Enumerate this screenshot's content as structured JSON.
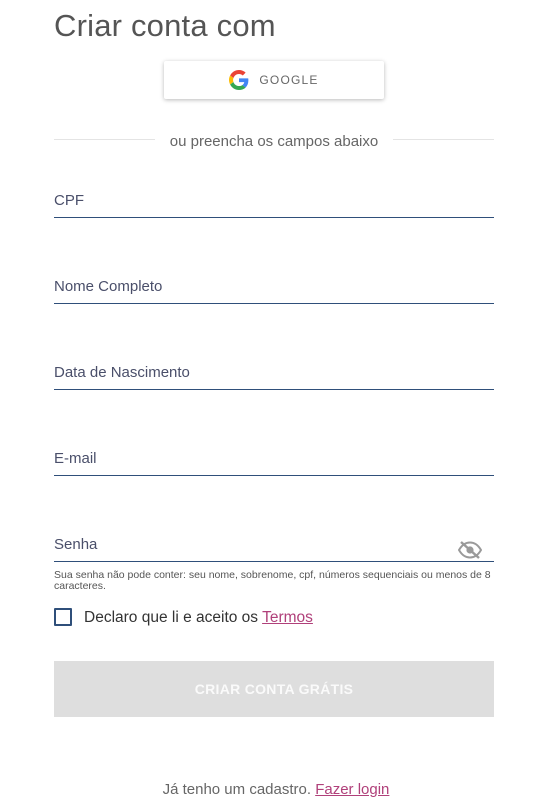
{
  "header": {
    "title": "Criar conta com"
  },
  "social": {
    "google_label": "GOOGLE",
    "icon": "google-icon"
  },
  "divider": {
    "text": "ou preencha os campos abaixo"
  },
  "form": {
    "fields": [
      {
        "label": "CPF",
        "value": ""
      },
      {
        "label": "Nome Completo",
        "value": ""
      },
      {
        "label": "Data de Nascimento",
        "value": ""
      },
      {
        "label": "E-mail",
        "value": ""
      },
      {
        "label": "Senha",
        "value": "",
        "icon": "eye-off-icon"
      }
    ],
    "password_hint": "Sua senha não pode conter: seu nome, sobrenome, cpf, números sequenciais ou menos de 8 caracteres.",
    "terms": {
      "prefix": "Declaro que li e aceito os ",
      "link": "Termos",
      "checked": false
    },
    "submit_label": "CRIAR CONTA GRÁTIS"
  },
  "footer": {
    "text": "Já tenho um cadastro. ",
    "link": "Fazer login"
  },
  "colors": {
    "accent": "#b0407a",
    "field_line": "#2f4f7a",
    "button_disabled": "#dedede"
  }
}
